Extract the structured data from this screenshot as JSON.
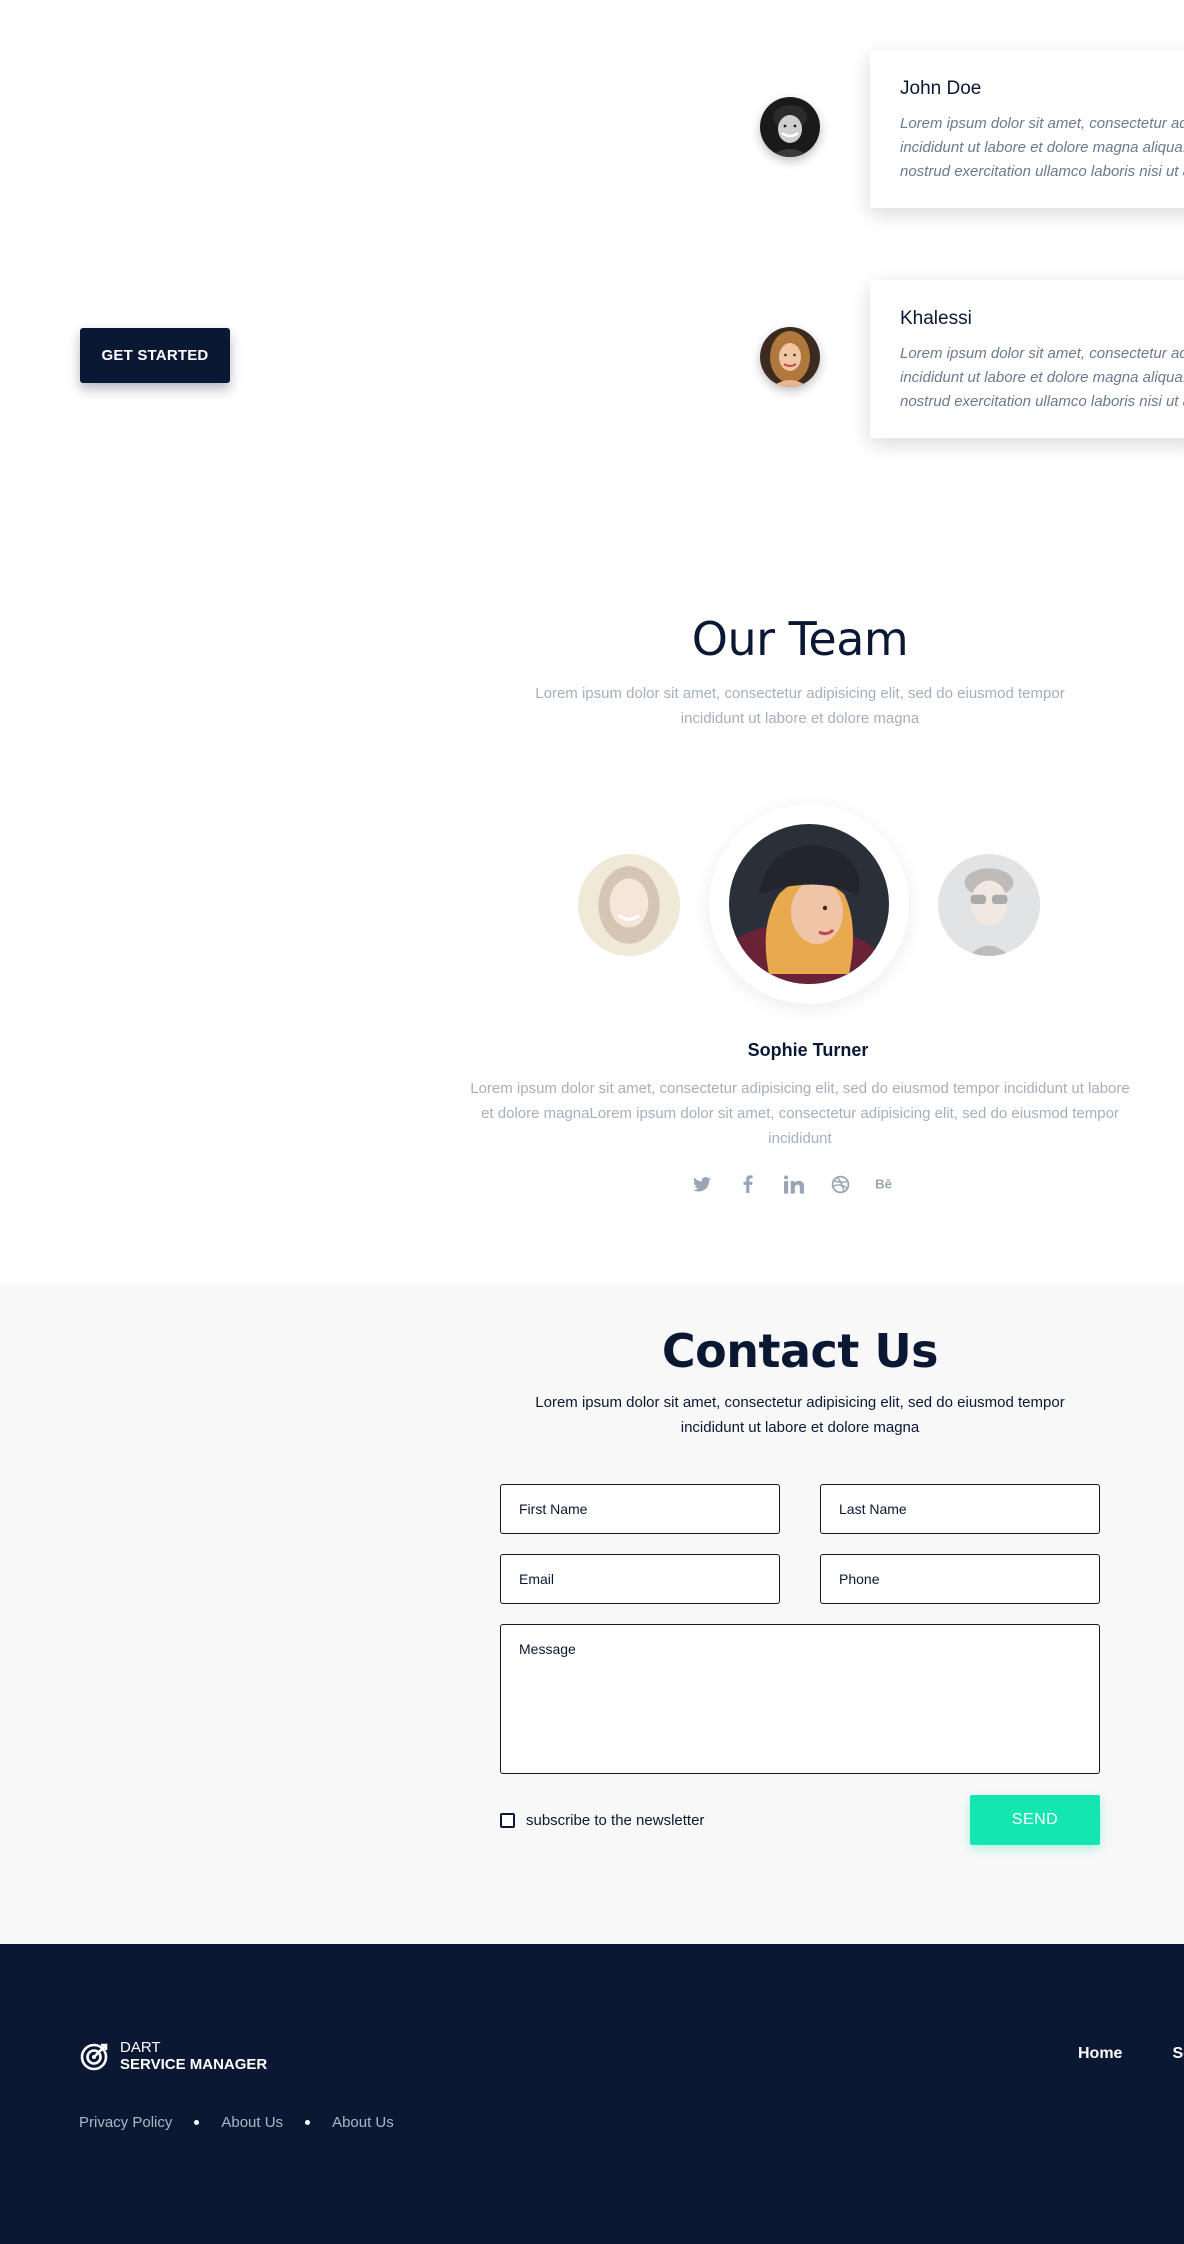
{
  "testimonials": [
    {
      "name": "John Doe",
      "text_lines": [
        "Lorem ipsum dolor sit amet, consectetur adipisicing elit, sed do eiusmod tempor",
        "incididunt ut labore et dolore magna aliqua. Ut enim ad minim veniam, quis",
        "nostrud exercitation ullamco laboris nisi ut aliquip ex ea commodo consequat."
      ],
      "avatar": "young-man-portrait"
    },
    {
      "name": "Khalessi",
      "text_lines": [
        "Lorem ipsum dolor sit amet, consectetur adipisicing elit, sed do eiusmod tempor",
        "incididunt ut labore et dolore magna aliqua. Ut enim ad minim veniam, quis",
        "nostrud exercitation ullamco laboris nisi ut aliquip ex ea commodo consequat."
      ],
      "avatar": "young-woman-portrait"
    }
  ],
  "hero": {
    "cta_label": "GET STARTED"
  },
  "team": {
    "title": "Our Team",
    "subtitle": "Lorem ipsum dolor sit amet, consectetur adipisicing elit, sed do eiusmod tempor incididunt ut labore et dolore magna",
    "members": [
      {
        "avatar": "smiling-woman-portrait",
        "active": false
      },
      {
        "avatar": "woman-in-beanie-portrait",
        "active": true
      },
      {
        "avatar": "man-with-sunglasses-portrait",
        "active": false
      }
    ],
    "active_member": {
      "name": "Sophie Turner",
      "bio": "Lorem ipsum dolor sit amet, consectetur adipisicing elit, sed do eiusmod tempor incididunt ut labore et dolore magnaLorem ipsum dolor sit amet, consectetur adipisicing elit, sed do eiusmod tempor incididunt"
    },
    "socials": [
      "twitter-icon",
      "facebook-icon",
      "linkedin-icon",
      "dribbble-icon",
      "behance-icon"
    ]
  },
  "contact": {
    "title": "Contact Us",
    "subtitle": "Lorem ipsum dolor sit amet, consectetur adipisicing elit, sed do eiusmod tempor incididunt ut labore et dolore magna",
    "fields": {
      "first_name": "First Name",
      "last_name": "Last Name",
      "email": "Email",
      "phone": "Phone",
      "message": "Message"
    },
    "newsletter_label": "subscribe to the newsletter",
    "send_label": "SEND"
  },
  "footer": {
    "logo_top": "DART",
    "logo_bottom": "SERVICE MANAGER",
    "nav": [
      "Home",
      "Services"
    ],
    "links": [
      "Privacy Policy",
      "About Us",
      "About Us"
    ]
  },
  "colors": {
    "navy": "#0a1833",
    "accent": "#14e6b1",
    "muted_text": "#a5afbd",
    "contact_bg": "#f8f8f8"
  }
}
